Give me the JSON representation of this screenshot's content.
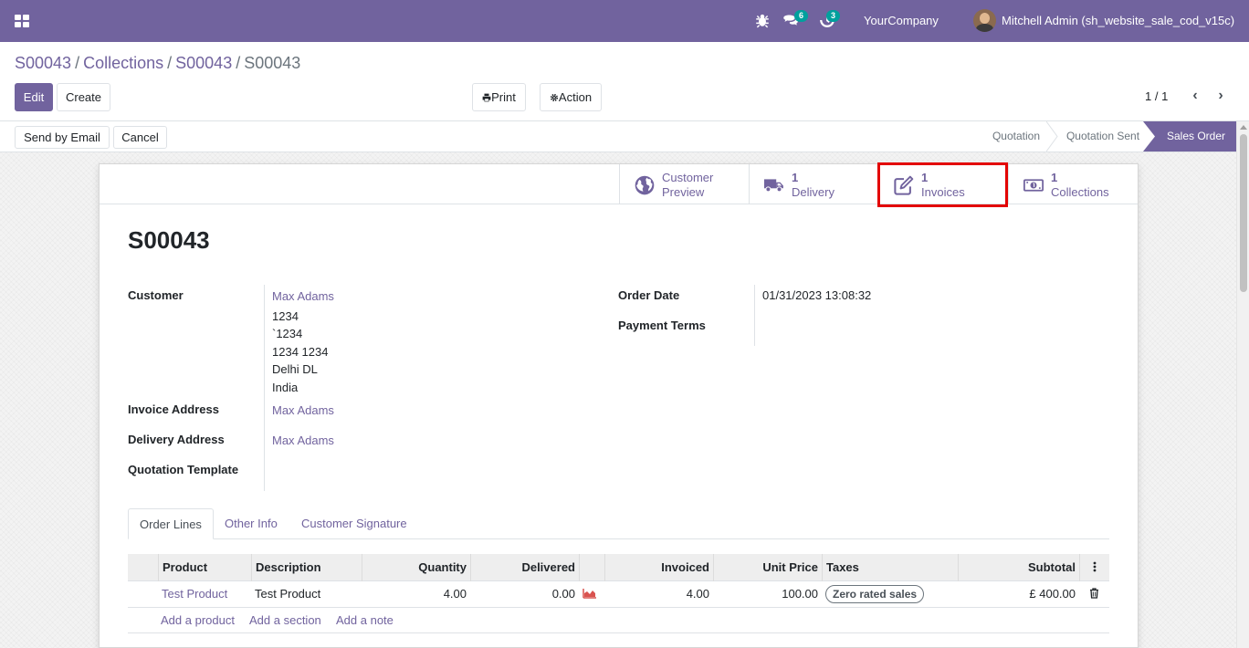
{
  "navbar": {
    "apps_icon": "apps-grid-icon",
    "debug_icon": "bug-icon",
    "messages_icon": "comments-icon",
    "messages_count": "6",
    "activities_icon": "clock-icon",
    "activities_count": "3",
    "company": "YourCompany",
    "user": "Mitchell Admin (sh_website_sale_cod_v15c)",
    "accent_color": "#71639e"
  },
  "breadcrumb": {
    "items": [
      "S00043",
      "Collections",
      "S00043"
    ],
    "current": "S00043",
    "separator": "/"
  },
  "toolbar": {
    "edit_label": "Edit",
    "create_label": "Create",
    "print_label": "Print",
    "action_label": "Action",
    "pager": "1 / 1"
  },
  "statusbar": {
    "send_email_label": "Send by Email",
    "cancel_label": "Cancel",
    "stages": [
      "Quotation",
      "Quotation Sent",
      "Sales Order"
    ],
    "active_stage": "Sales Order"
  },
  "smart_buttons": {
    "preview": {
      "value": "",
      "label1": "Customer",
      "label2": "Preview",
      "icon": "globe-icon"
    },
    "delivery": {
      "value": "1",
      "label": "Delivery",
      "icon": "truck-icon"
    },
    "invoices": {
      "value": "1",
      "label": "Invoices",
      "icon": "pencil-square-icon"
    },
    "collections": {
      "value": "1",
      "label": "Collections",
      "icon": "money-icon"
    }
  },
  "form": {
    "title": "S00043",
    "customer_label": "Customer",
    "customer_name": "Max Adams",
    "customer_address": [
      "1234",
      "`1234",
      "1234 1234",
      "Delhi DL",
      "India"
    ],
    "invoice_address_label": "Invoice Address",
    "invoice_address": "Max Adams",
    "delivery_address_label": "Delivery Address",
    "delivery_address": "Max Adams",
    "quotation_template_label": "Quotation Template",
    "order_date_label": "Order Date",
    "order_date": "01/31/2023 13:08:32",
    "payment_terms_label": "Payment Terms"
  },
  "tabs": [
    "Order Lines",
    "Other Info",
    "Customer Signature"
  ],
  "order_lines": {
    "columns": [
      "Product",
      "Description",
      "Quantity",
      "Delivered",
      "Invoiced",
      "Unit Price",
      "Taxes",
      "Subtotal"
    ],
    "rows": [
      {
        "product": "Test Product",
        "description": "Test Product",
        "quantity": "4.00",
        "delivered": "0.00",
        "invoiced": "4.00",
        "unit_price": "100.00",
        "taxes": "Zero rated sales",
        "subtotal": "£ 400.00"
      }
    ],
    "add_product": "Add a product",
    "add_section": "Add a section",
    "add_note": "Add a note"
  }
}
